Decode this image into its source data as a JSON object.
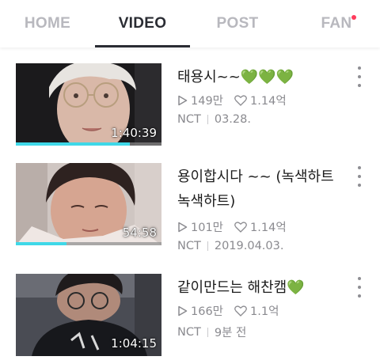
{
  "tabs": [
    {
      "label": "HOME",
      "active": false
    },
    {
      "label": "VIDEO",
      "active": true
    },
    {
      "label": "POST",
      "active": false
    },
    {
      "label": "FAN",
      "active": false,
      "badge": "new-dot"
    }
  ],
  "colors": {
    "accent_progress": "#3fd8e8",
    "active_tab": "#2a2c33",
    "inactive_tab": "#b8b8be",
    "badge": "#ff3b5c",
    "heart_emoji": "#6cc24a"
  },
  "videos": [
    {
      "title": "태용시~~💚💚💚",
      "duration": "1:40:39",
      "progress": 0.78,
      "views": "149만",
      "likes": "1.14억",
      "channel": "NCT",
      "date": "03.28."
    },
    {
      "title": "용이합시다 ~~ (녹색하트 녹색하트)",
      "duration": "54:58",
      "progress": 0.35,
      "views": "101만",
      "likes": "1.14억",
      "channel": "NCT",
      "date": "2019.04.03."
    },
    {
      "title": "같이만드는 해찬캠💚",
      "duration": "1:04:15",
      "progress": 0,
      "views": "166만",
      "likes": "1.1억",
      "channel": "NCT",
      "date": "9분 전"
    }
  ],
  "icons": {
    "views": "play-outline-icon",
    "likes": "heart-outline-icon",
    "more": "more-vertical-icon"
  }
}
